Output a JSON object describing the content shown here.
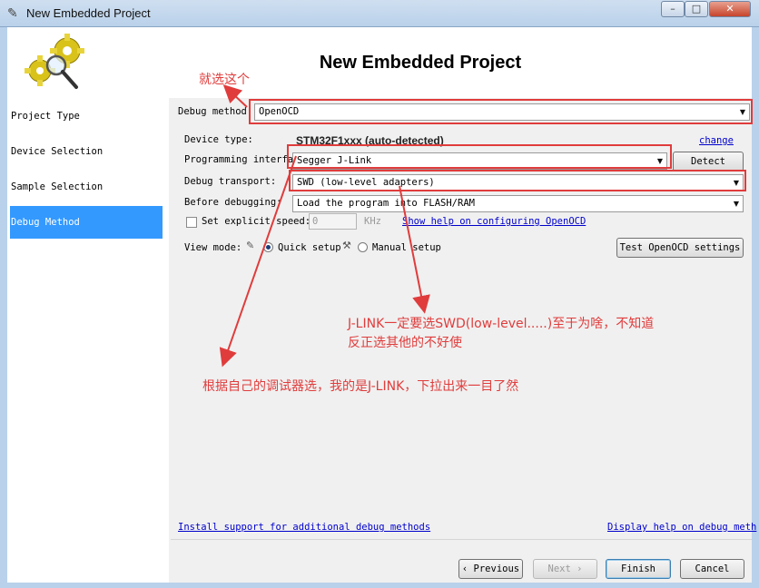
{
  "window": {
    "title": "New Embedded Project",
    "app_icon": "wizard-icon",
    "controls": {
      "minimize": "–",
      "maximize": "□",
      "close": "✕"
    }
  },
  "header": {
    "title": "New Embedded Project",
    "icon": "gears-magnifier-icon"
  },
  "nav": {
    "items": [
      {
        "label": "Project Type",
        "active": false
      },
      {
        "label": "Device Selection",
        "active": false
      },
      {
        "label": "Sample Selection",
        "active": false
      },
      {
        "label": "Debug Method",
        "active": true
      }
    ]
  },
  "form": {
    "debug_method": {
      "label": "Debug method:",
      "value": "OpenOCD"
    },
    "device_type": {
      "label": "Device type:",
      "value": "STM32F1xxx (auto-detected)",
      "change_link": "change"
    },
    "programming_interface": {
      "label": "Programming interface:",
      "value": "Segger J-Link",
      "detect_button": "Detect"
    },
    "debug_transport": {
      "label": "Debug transport:",
      "value": "SWD (low-level adapters)"
    },
    "before_debugging": {
      "label": "Before debugging:",
      "value": "Load the program into FLASH/RAM"
    },
    "explicit_speed": {
      "label": "Set explicit speed:",
      "checked": false,
      "value": "0",
      "unit": "KHz"
    },
    "help_link": "Show help on configuring OpenOCD",
    "view_mode": {
      "label": "View mode:",
      "quick": "Quick setup",
      "manual": "Manual setup",
      "selected": "quick"
    },
    "test_button": "Test OpenOCD settings"
  },
  "footer": {
    "install_link": "Install support for additional debug methods",
    "help_link": "Display help on debug meth",
    "buttons": {
      "previous": "Previous",
      "next": "Next",
      "finish": "Finish",
      "cancel": "Cancel"
    }
  },
  "annotations": {
    "note1": "就选这个",
    "note2_line1": "J-LINK一定要选SWD(low-level.....)至于为啥，不知道",
    "note2_line2": "反正选其他的不好使",
    "note3": "根据自己的调试器选，我的是J-LINK，下拉出来一目了然",
    "color": "#e03c3c"
  }
}
